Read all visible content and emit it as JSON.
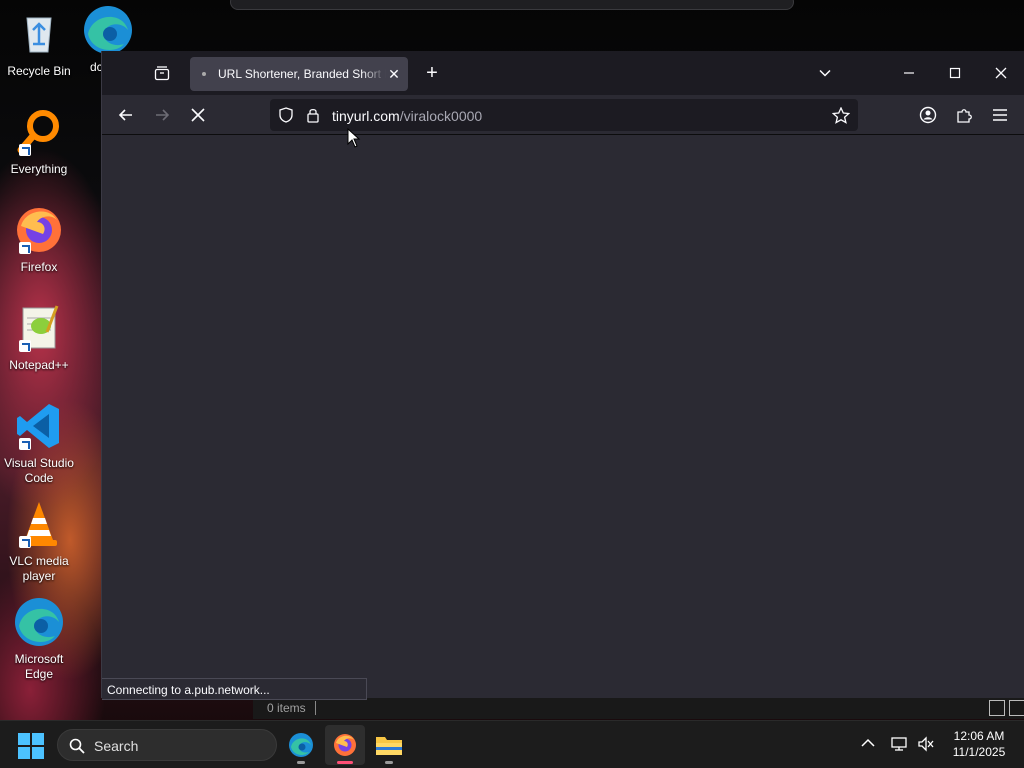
{
  "desktop": {
    "icons": [
      {
        "label": "Recycle Bin"
      },
      {
        "label": "dc"
      },
      {
        "label": "Everything"
      },
      {
        "label": "Firefox"
      },
      {
        "label": "Notepad++"
      },
      {
        "label": "Visual Studio Code"
      },
      {
        "label": "VLC media player"
      },
      {
        "label": "Microsoft Edge"
      }
    ]
  },
  "browser": {
    "tab": {
      "title": "URL Shortener, Branded Short Links & Analytics | TinyURL",
      "close": "✕"
    },
    "new_tab": "+",
    "url": {
      "host": "tinyurl.com",
      "path": "/viralock0000"
    },
    "status": "Connecting to a.pub.network...",
    "loading": true
  },
  "explorer": {
    "items_count": "0 items"
  },
  "taskbar": {
    "search_label": "Search",
    "clock": {
      "time": "12:06 AM",
      "date": "11/1/2025"
    },
    "apps": [
      "edge-icon",
      "firefox-icon",
      "file-explorer-icon"
    ],
    "active_app": "firefox-icon"
  },
  "colors": {
    "accent_firefox": "#ff4f76",
    "toolbar": "#2b2a33",
    "tabbar": "#1c1b22",
    "tab_active": "#42414d",
    "windows_blue": "#4cc2ff"
  }
}
